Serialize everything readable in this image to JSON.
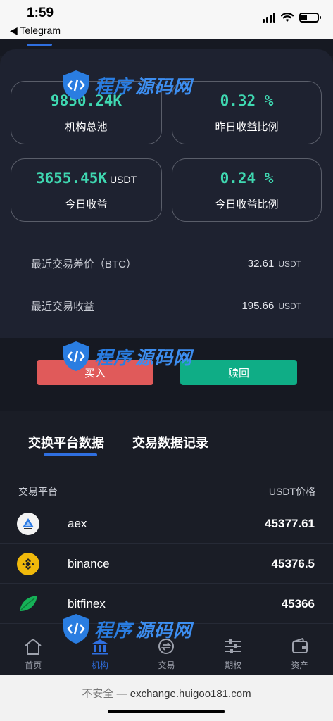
{
  "status_bar": {
    "time": "1:59",
    "back_app": "◀ Telegram"
  },
  "stats": [
    {
      "value": "9850.24K",
      "unit": "",
      "label": "机构总池"
    },
    {
      "value": "0.32 %",
      "unit": "",
      "label": "昨日收益比例"
    },
    {
      "value": "3655.45K",
      "unit": "USDT",
      "label": "今日收益"
    },
    {
      "value": "0.24 %",
      "unit": "",
      "label": "今日收益比例"
    }
  ],
  "info": [
    {
      "label": "最近交易差价（BTC）",
      "value": "32.61",
      "unit": "USDT"
    },
    {
      "label": "最近交易收益",
      "value": "195.66",
      "unit": "USDT"
    }
  ],
  "buttons": {
    "buy": "买入",
    "redeem": "赎回"
  },
  "exchange_tabs": [
    "交换平台数据",
    "交易数据记录"
  ],
  "table": {
    "headers": [
      "交易平台",
      "USDT价格"
    ],
    "rows": [
      {
        "name": "aex",
        "price": "45377.61",
        "icon": "aex-logo-icon"
      },
      {
        "name": "binance",
        "price": "45376.5",
        "icon": "binance-logo-icon"
      },
      {
        "name": "bitfinex",
        "price": "45366",
        "icon": "bitfinex-logo-icon"
      }
    ]
  },
  "nav": [
    {
      "label": "首页",
      "icon": "home-icon"
    },
    {
      "label": "机构",
      "icon": "institution-icon",
      "active": true
    },
    {
      "label": "交易",
      "icon": "exchange-icon"
    },
    {
      "label": "期权",
      "icon": "sliders-icon"
    },
    {
      "label": "资产",
      "icon": "wallet-icon"
    }
  ],
  "url_bar": {
    "insecure": "不安全 — ",
    "domain": "exchange.huigoo181.com"
  },
  "watermark": {
    "text_a": "程序",
    "text_b": "源码网"
  },
  "colors": {
    "accent": "#3fd8b1",
    "buy": "#e05a5a",
    "redeem": "#0fad86",
    "active_blue": "#2f6fe0"
  }
}
